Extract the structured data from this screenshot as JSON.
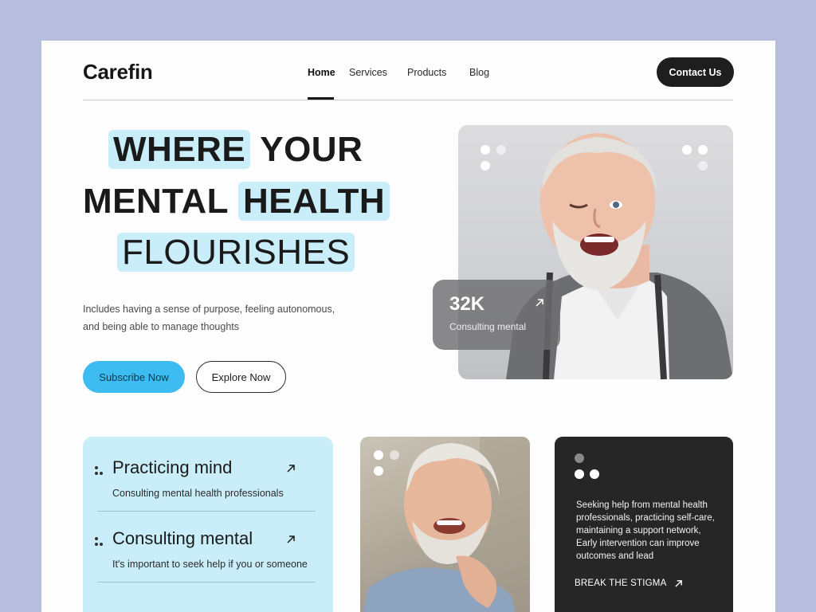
{
  "header": {
    "logo": "Carefin",
    "nav": [
      "Home",
      "Services",
      "Products",
      "Blog"
    ],
    "active_nav": "Home",
    "contact_label": "Contact Us"
  },
  "hero": {
    "line1_highlight": "WHERE",
    "line1_rest": "YOUR",
    "line2_plain": "MENTAL",
    "line2_highlight": "HEALTH",
    "line3_highlight": "FLOURISHES",
    "description_line1": "Includes having a sense of purpose, feeling autonomous,",
    "description_line2": "and being able to manage thoughts",
    "subscribe_label": "Subscribe Now",
    "explore_label": "Explore Now"
  },
  "stat_card": {
    "value": "32K",
    "label": "Consulting mental"
  },
  "practice_card": {
    "items": [
      {
        "title": "Practicing mind",
        "subtitle": "Consulting mental health professionals"
      },
      {
        "title": "Consulting mental",
        "subtitle": "It's important to seek help if you or someone"
      }
    ]
  },
  "dark_card": {
    "text": "Seeking help from mental health professionals, practicing self-care, maintaining a support network, Early intervention can improve outcomes and lead",
    "cta": "BREAK THE STIGMA"
  },
  "colors": {
    "background": "#b7bddd",
    "highlight": "#c9eefa",
    "accent_blue": "#3dbcf2",
    "dark": "#1e1e1e"
  },
  "icons": [
    "arrow-up-right-icon",
    "dots-icon"
  ]
}
